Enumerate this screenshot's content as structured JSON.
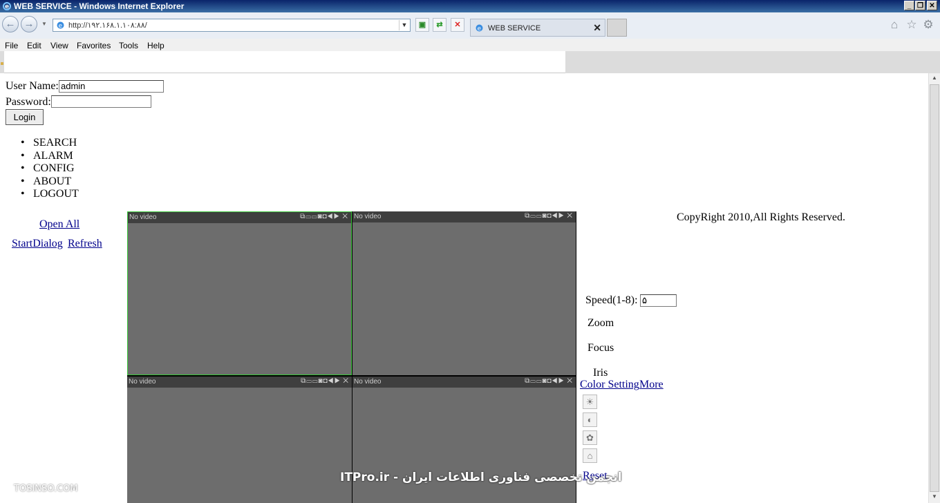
{
  "window": {
    "title": "WEB SERVICE - Windows Internet Explorer",
    "controls": [
      "_",
      "❐",
      "✕"
    ]
  },
  "browser": {
    "url": "http://۱۹۲.۱۶۸.۱.۱۰۸:۸۸/",
    "tab_title": "WEB SERVICE",
    "back_icon": "back-arrow-icon",
    "forward_icon": "forward-arrow-icon"
  },
  "menu": {
    "items": [
      "File",
      "Edit",
      "View",
      "Favorites",
      "Tools",
      "Help"
    ]
  },
  "login": {
    "username_label": "User Name:",
    "username_value": "admin",
    "password_label": "Password:",
    "password_value": "",
    "login_button": "Login"
  },
  "nav": {
    "items": [
      "SEARCH",
      "ALARM",
      "CONFIG",
      "ABOUT",
      "LOGOUT"
    ]
  },
  "left_links": {
    "open_all": "Open All",
    "start_dialog": "StartDialog",
    "refresh": "Refresh"
  },
  "video": {
    "cells": [
      {
        "label": "No video"
      },
      {
        "label": "No video"
      },
      {
        "label": "No video"
      },
      {
        "label": "No video"
      }
    ],
    "toolbar": "⧉▭▭◙◘◀▶ ✕"
  },
  "copyright": "CopyRight 2010,All Rights Reserved.",
  "ptz": {
    "speed_label": "Speed(1-8):",
    "speed_value": "۵",
    "zoom": "Zoom",
    "focus": "Focus",
    "iris": "Iris",
    "color_setting": "Color Setting",
    "more": "More",
    "reset": "Reset"
  },
  "watermarks": {
    "left": "TOSINSO.COM",
    "center": "ITPro.ir - انجمن تخصصی فناوری اطلاعات ایران"
  },
  "colors": {
    "selected_border": "#39c639",
    "video_bg": "#6d6d6d",
    "link": "#00008b"
  }
}
